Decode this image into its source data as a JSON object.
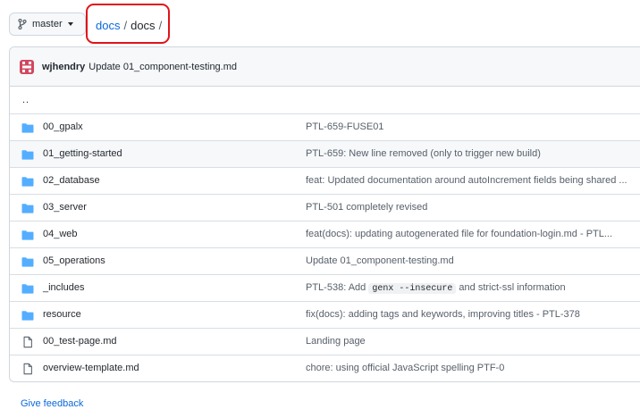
{
  "branch": {
    "name": "master",
    "icon": "git-branch-icon"
  },
  "breadcrumb": {
    "link": "docs",
    "separator": "/",
    "current": "docs",
    "trailing": "/",
    "highlight_color": "#e0131a"
  },
  "commit": {
    "author": "wjhendry",
    "message": "Update 01_component-testing.md",
    "avatar_color": "#d1485f"
  },
  "parent_link": "..",
  "files": [
    {
      "type": "folder",
      "name": "00_gpalx",
      "message": "PTL-659-FUSE01"
    },
    {
      "type": "folder",
      "name": "01_getting-started",
      "message": "PTL-659: New line removed (only to trigger new build)",
      "highlighted": true
    },
    {
      "type": "folder",
      "name": "02_database",
      "message": "feat: Updated documentation around autoIncrement fields being shared ..."
    },
    {
      "type": "folder",
      "name": "03_server",
      "message": "PTL-501 completely revised"
    },
    {
      "type": "folder",
      "name": "04_web",
      "message": "feat(docs): updating autogenerated file for foundation-login.md - PTL..."
    },
    {
      "type": "folder",
      "name": "05_operations",
      "message": "Update 01_component-testing.md"
    },
    {
      "type": "folder",
      "name": "_includes",
      "message_parts": {
        "before": "PTL-538: Add",
        "code": "genx --insecure",
        "after": "and strict-ssl information"
      }
    },
    {
      "type": "folder",
      "name": "resource",
      "message": "fix(docs): adding tags and keywords, improving titles - PTL-378"
    },
    {
      "type": "file",
      "name": "00_test-page.md",
      "message": "Landing page"
    },
    {
      "type": "file",
      "name": "overview-template.md",
      "message": "chore: using official JavaScript spelling PTF-0"
    }
  ],
  "feedback_label": "Give feedback",
  "colors": {
    "folder": "#54aeff",
    "link": "#0969da",
    "file_icon": "#57606a"
  }
}
